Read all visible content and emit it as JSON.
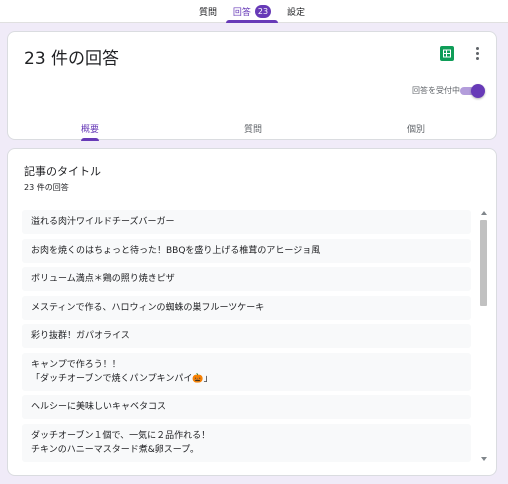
{
  "top_tabs": [
    {
      "label": "質問"
    },
    {
      "label": "回答",
      "badge": "23"
    },
    {
      "label": "設定"
    }
  ],
  "summary_card": {
    "title": "23 件の回答",
    "accepting_label": "回答を受付中",
    "accepting": true,
    "sub_tabs": [
      {
        "label": "概要",
        "active": true
      },
      {
        "label": "質問",
        "active": false
      },
      {
        "label": "個別",
        "active": false
      }
    ]
  },
  "question": {
    "title": "記事のタイトル",
    "response_count": "23 件の回答",
    "responses": [
      {
        "lines": [
          "溢れる肉汁ワイルドチーズバーガー"
        ]
      },
      {
        "lines": [
          "お肉を焼くのはちょっと待った！BBQを盛り上げる椎茸のアヒージョ風"
        ]
      },
      {
        "lines": [
          "ボリューム満点＊鶏の照り焼きピザ"
        ]
      },
      {
        "lines": [
          "メスティンで作る、ハロウィンの蜘蛛の巣フルーツケーキ"
        ]
      },
      {
        "lines": [
          "彩り抜群！ガパオライス"
        ]
      },
      {
        "lines": [
          "キャンプで作ろう！！",
          "「ダッチオーブンで焼くパンプキンパイ🎃」"
        ]
      },
      {
        "lines": [
          "ヘルシーに美味しいキャベタコス"
        ]
      },
      {
        "lines": [
          "ダッチオーブン１個で、一気に２品作れる！",
          "チキンのハニーマスタード煮&卵スープ。"
        ]
      }
    ]
  },
  "colors": {
    "accent": "#673ab7",
    "background": "#f0ebf8",
    "sheets_green": "#0f9d58"
  },
  "icons": {
    "sheets": "google-sheets-icon",
    "more": "more-vert-icon"
  }
}
